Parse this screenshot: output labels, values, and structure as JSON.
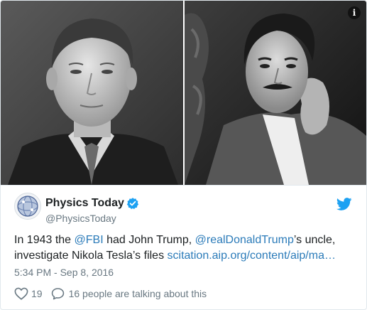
{
  "tweet": {
    "author_name": "Physics Today",
    "author_handle": "@PhysicsToday",
    "text": {
      "line1_prefix": "In 1943 the ",
      "mention_fbi": "@FBI",
      "line1_mid": " had John Trump, ",
      "mention_trump": "@realDonaldTrump",
      "line1_suffix": "’s uncle,",
      "line2_prefix": "investigate Nikola Tesla’s files ",
      "link": "scitation.aip.org/content/aip/ma…"
    },
    "timestamp": "5:34 PM - Sep 8, 2016",
    "like_count": "19",
    "talking_text": "16 people are talking about this"
  },
  "icons": {
    "info": "i",
    "verified": "verified-badge-icon",
    "brand": "twitter-bird-icon",
    "like": "heart-outline-icon",
    "reply": "speech-bubble-icon"
  },
  "colors": {
    "link": "#2b7bb9",
    "brand": "#1da1f2",
    "muted": "#697882",
    "text": "#1c2022",
    "border": "#e1e8ed"
  }
}
